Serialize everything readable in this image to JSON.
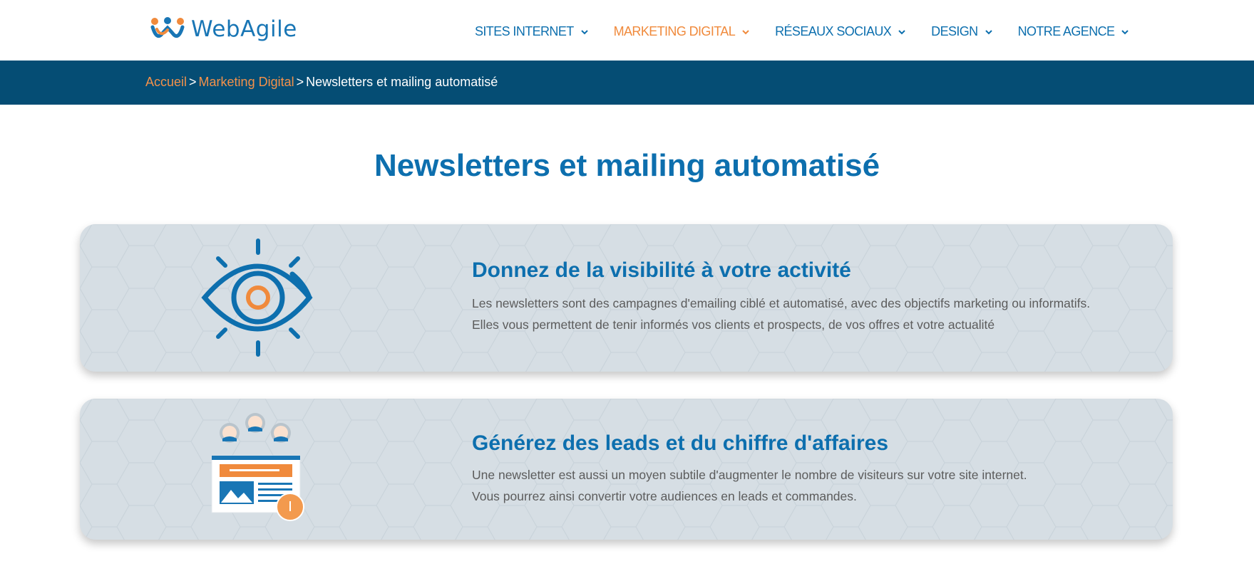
{
  "header": {
    "logo_text": "WebAgile",
    "nav": [
      {
        "label": "SITES INTERNET",
        "active": false
      },
      {
        "label": "MARKETING DIGITAL",
        "active": true
      },
      {
        "label": "RÉSEAUX SOCIAUX",
        "active": false
      },
      {
        "label": "DESIGN",
        "active": false
      },
      {
        "label": "NOTRE AGENCE",
        "active": false
      }
    ]
  },
  "breadcrumb": {
    "home": "Accueil",
    "separator": ">",
    "section": "Marketing Digital",
    "current": "Newsletters et mailing automatisé"
  },
  "page_title": "Newsletters et mailing automatisé",
  "cards": [
    {
      "icon": "eye-icon",
      "title": "Donnez de la visibilité à votre activité",
      "lines": [
        "Les newsletters sont des campagnes d'emailing ciblé et automatisé, avec des objectifs marketing ou informatifs.",
        "Elles vous permettent de tenir informés vos clients et prospects, de vos offres et votre actualité"
      ]
    },
    {
      "icon": "newsletter-audience-icon",
      "title": "Générez des leads et du chiffre d'affaires",
      "lines": [
        "Une newsletter est aussi un moyen subtile d'augmenter le nombre de visiteurs sur votre site internet.",
        "Vous pourrez ainsi convertir votre audiences en leads et commandes."
      ]
    }
  ],
  "colors": {
    "brand_blue": "#0d6fae",
    "brand_orange": "#f08a3c",
    "breadcrumb_bg": "#054d74",
    "card_bg": "#d6dee4"
  }
}
